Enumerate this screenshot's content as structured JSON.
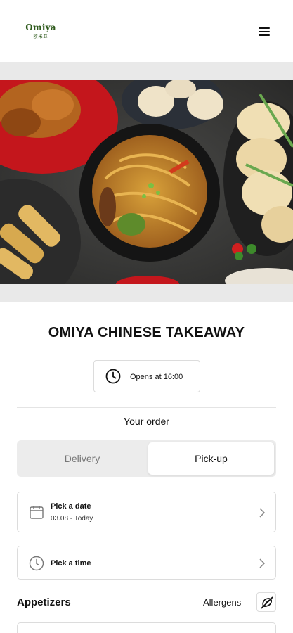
{
  "header": {
    "logo_text": "Omiya",
    "logo_subtext": "欧米亚",
    "menu_icon": "hamburger-menu-icon"
  },
  "hero": {
    "image": "food-spread-photo"
  },
  "restaurant": {
    "name": "OMIYA CHINESE TAKEAWAY",
    "opens_label": "Opens at 16:00",
    "opens_icon": "clock-icon"
  },
  "order": {
    "heading": "Your order",
    "toggle": {
      "delivery_label": "Delivery",
      "pickup_label": "Pick-up",
      "selected": "Pick-up"
    },
    "date": {
      "label": "Pick a date",
      "value": "03.08 - Today",
      "icon": "calendar-icon"
    },
    "time": {
      "label": "Pick a time",
      "icon": "clock-icon"
    }
  },
  "menu": {
    "section_title": "Appetizers",
    "allergens_label": "Allergens",
    "allergens_icon": "no-allergen-icon"
  },
  "colors": {
    "logo": "#2e5a1c",
    "toggle_bg": "#ececec",
    "border": "#dcdcdc"
  }
}
